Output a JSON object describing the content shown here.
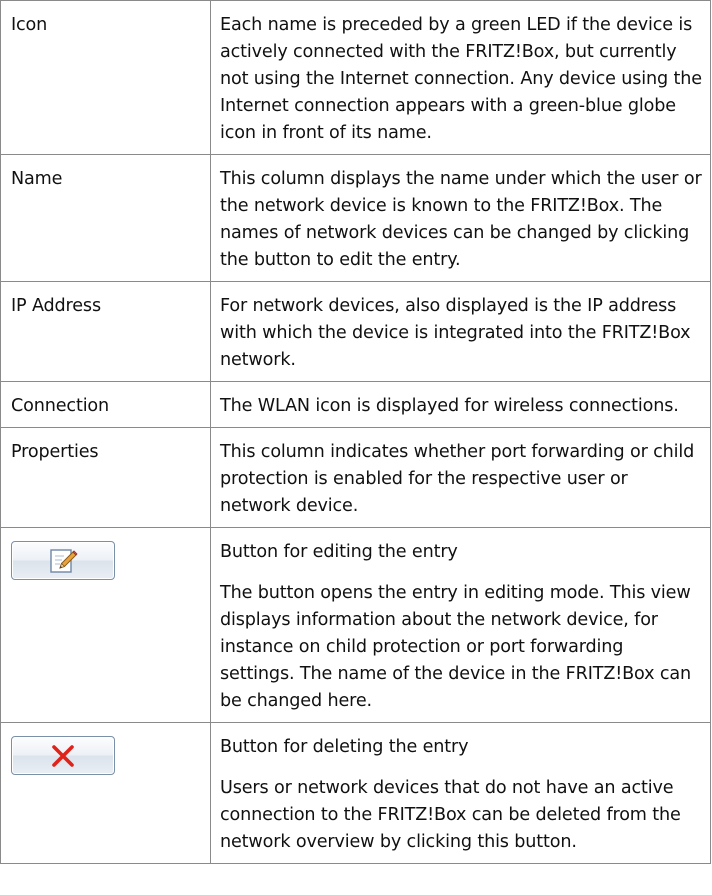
{
  "rows": [
    {
      "term": "Icon",
      "description": "Each name is preceded by a green LED if the de­vice is actively connected with the FRITZ!Box, but currently not using the Internet connection. Any device using the Internet connection appears with a green-blue globe icon in front of its name."
    },
    {
      "term": "Name",
      "description": "This column displays the name under which the user or the network device is known to the FRITZ!Box. The names of network devices can be changed by clicking the button to edit the entry."
    },
    {
      "term": "IP Address",
      "description": "For network devices, also displayed is the IP ad­dress with which the device is integrated into the FRITZ!Box network."
    },
    {
      "term": "Connection",
      "description": "The WLAN icon is displayed for wireless connec­tions."
    },
    {
      "term": "Properties",
      "description": "This column indicates whether port forwarding or child protection is enabled for the respective user or network device."
    }
  ],
  "edit_row": {
    "icon": "edit-pencil-icon",
    "title": "Button for editing the entry",
    "description": "The button opens the entry in editing mode. This view displays information about the network de­vice, for instance on child protection or port for­warding settings. The name of the device in the FRITZ!Box can be changed here."
  },
  "delete_row": {
    "icon": "delete-x-icon",
    "title": "Button for deleting the entry",
    "description": "Users or network devices that do not have an ac­tive connection to the FRITZ!Box can be deleted from the network overview by clicking this button."
  },
  "colors": {
    "border": "#8a8a8a",
    "delete_red": "#e0231a",
    "edit_blue": "#3d7cc9"
  }
}
